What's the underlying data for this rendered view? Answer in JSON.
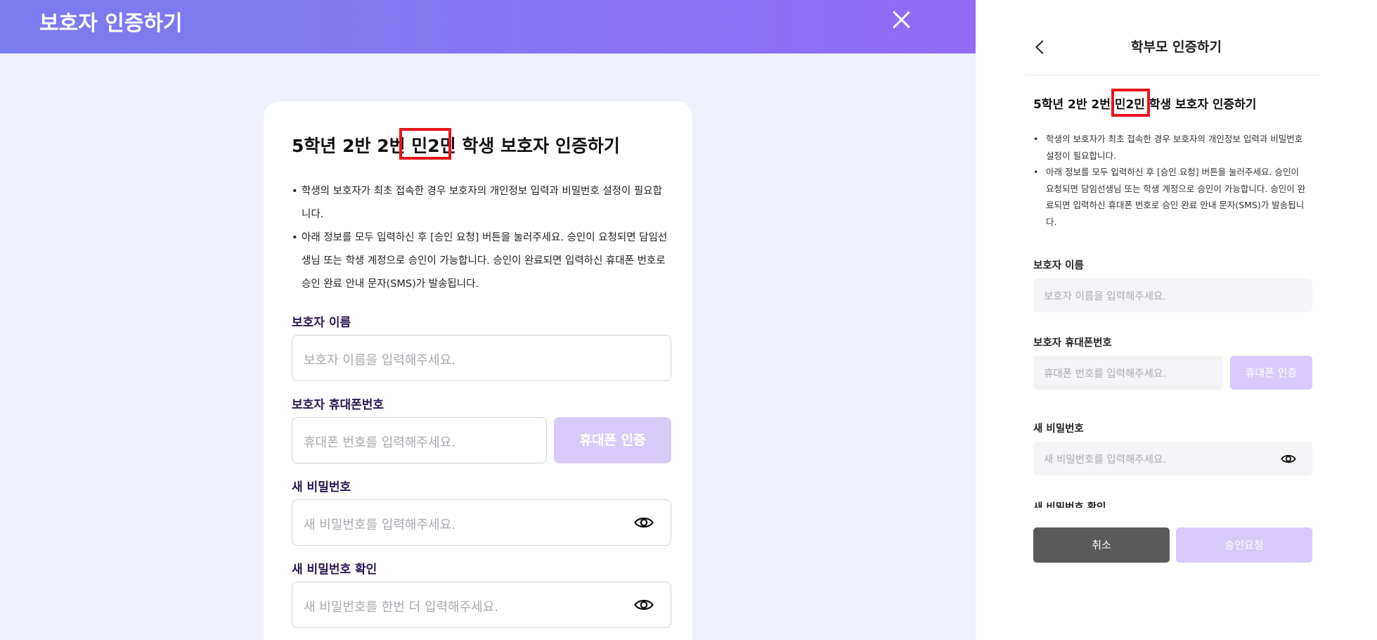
{
  "desktop": {
    "header": {
      "title": "보호자 인증하기"
    },
    "card": {
      "title_pre": "5학년 2반 2번 ",
      "title_name": "민2민",
      "title_post": " 학생 보호자 인증하기",
      "notes": [
        "학생의 보호자가 최초 접속한 경우 보호자의 개인정보 입력과 비밀번호 설정이 필요합니다.",
        "아래 정보를 모두 입력하신 후 [승인 요청] 버튼을 눌러주세요. 승인이 요청되면 담임선생님 또는 학생 계정으로 승인이 가능합니다. 승인이 완료되면 입력하신 휴대폰 번호로 승인 완료 안내 문자(SMS)가 발송됩니다."
      ],
      "name_label": "보호자 이름",
      "name_placeholder": "보호자 이름을 입력해주세요.",
      "phone_label": "보호자 휴대폰번호",
      "phone_placeholder": "휴대폰 번호를 입력해주세요.",
      "phone_auth_button": "휴대폰 인증",
      "pw_label": "새 비밀번호",
      "pw_placeholder": "새 비밀번호를 입력해주세요.",
      "pw_confirm_label": "새 비밀번호 확인",
      "pw_confirm_placeholder": "새 비밀번호를 한번 더 입력해주세요."
    }
  },
  "mobile": {
    "header": {
      "title": "학부모 인증하기"
    },
    "title_pre": "5학년 2반 2번 ",
    "title_name": "민2민",
    "title_post": " 학생 보호자 인증하기",
    "notes": [
      "학생의 보호자가 최초 접속한 경우 보호자의 개인정보 입력과 비밀번호 설정이 필요합니다.",
      "아래 정보를 모두 입력하신 후 [승인 요청] 버튼을 눌러주세요. 승인이 요청되면 담임선생님 또는 학생 계정으로 승인이 가능합니다. 승인이 완료되면 입력하신 휴대폰 번호로 승인 완료 안내 문자(SMS)가 발송됩니다."
    ],
    "name_label": "보호자 이름",
    "name_placeholder": "보호자 이름을 입력해주세요.",
    "phone_label": "보호자 휴대폰번호",
    "phone_placeholder": "휴대폰 번호를 입력해주세요.",
    "phone_auth_button": "휴대폰 인증",
    "pw_label": "새 비밀번호",
    "pw_placeholder": "새 비밀번호를 입력해주세요.",
    "pw_confirm_label": "새 비밀번호 확인",
    "cancel_button": "취소",
    "submit_button": "승인요청"
  },
  "colors": {
    "header_gradient_start": "#7b7cf0",
    "header_gradient_end": "#8f6cf2",
    "highlight_box": "#e8141c",
    "disabled_button": "#d8cbfb",
    "cancel_button": "#5a5a5a"
  }
}
